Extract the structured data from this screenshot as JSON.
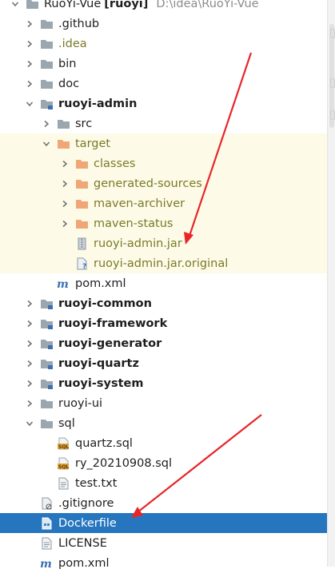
{
  "project": {
    "name": "RuoYi-Vue",
    "module_tag": "[ruoyi]",
    "path": "D:\\idea\\RuoYi-Vue"
  },
  "rows": {
    "github": ".github",
    "idea": ".idea",
    "bin": "bin",
    "doc": "doc",
    "ruoyi_admin": "ruoyi-admin",
    "src": "src",
    "target": "target",
    "classes": "classes",
    "generated_sources": "generated-sources",
    "maven_archiver": "maven-archiver",
    "maven_status": "maven-status",
    "admin_jar": "ruoyi-admin.jar",
    "admin_jar_original": "ruoyi-admin.jar.original",
    "admin_pom": "pom.xml",
    "ruoyi_common": "ruoyi-common",
    "ruoyi_framework": "ruoyi-framework",
    "ruoyi_generator": "ruoyi-generator",
    "ruoyi_quartz": "ruoyi-quartz",
    "ruoyi_system": "ruoyi-system",
    "ruoyi_ui": "ruoyi-ui",
    "sql": "sql",
    "quartz_sql": "quartz.sql",
    "ry_sql": "ry_20210908.sql",
    "test_txt": "test.txt",
    "gitignore": ".gitignore",
    "dockerfile": "Dockerfile",
    "license": "LICENSE",
    "root_pom": "pom.xml"
  },
  "colors": {
    "folder": "#9aa7b0",
    "excluded_folder": "#f0a778",
    "selection": "#2675bf",
    "highlight": "#fdfbe8",
    "annotation_arrow": "#e8262a"
  }
}
